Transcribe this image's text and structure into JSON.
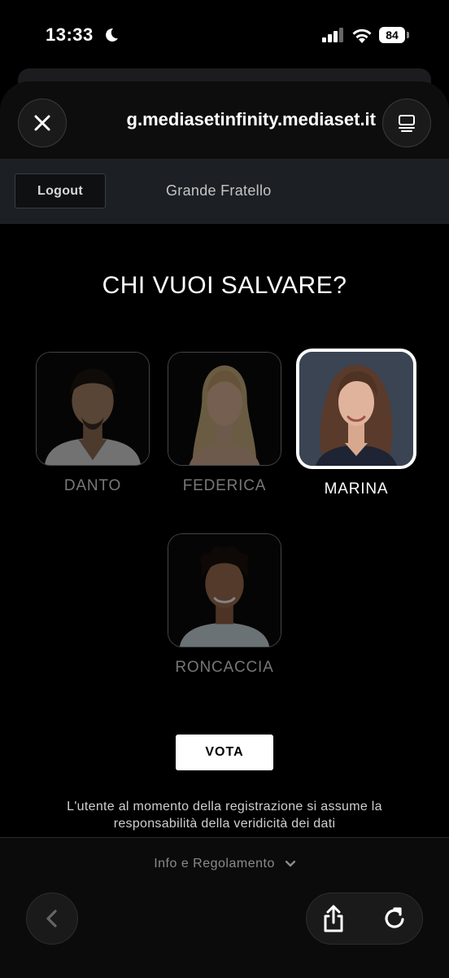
{
  "status_bar": {
    "time": "13:33",
    "battery": "84"
  },
  "browser": {
    "url": "g.mediasetinfinity.mediaset.it"
  },
  "header": {
    "logout_label": "Logout",
    "show_title": "Grande Fratello"
  },
  "vote": {
    "question": "CHI VUOI SALVARE?",
    "candidates": [
      {
        "name": "DANTO",
        "selected": false
      },
      {
        "name": "FEDERICA",
        "selected": false
      },
      {
        "name": "MARINA",
        "selected": true
      },
      {
        "name": "RONCACCIA",
        "selected": false
      }
    ],
    "submit_label": "VOTA",
    "disclaimer": "L'utente al momento della registrazione si assume la responsabilità della veridicità dei dati"
  },
  "footer": {
    "info_link": "Info e Regolamento"
  },
  "colors": {
    "background": "#000000",
    "header_bg": "#1c2024",
    "selected_border": "#ffffff",
    "unselected_name": "#777777"
  }
}
